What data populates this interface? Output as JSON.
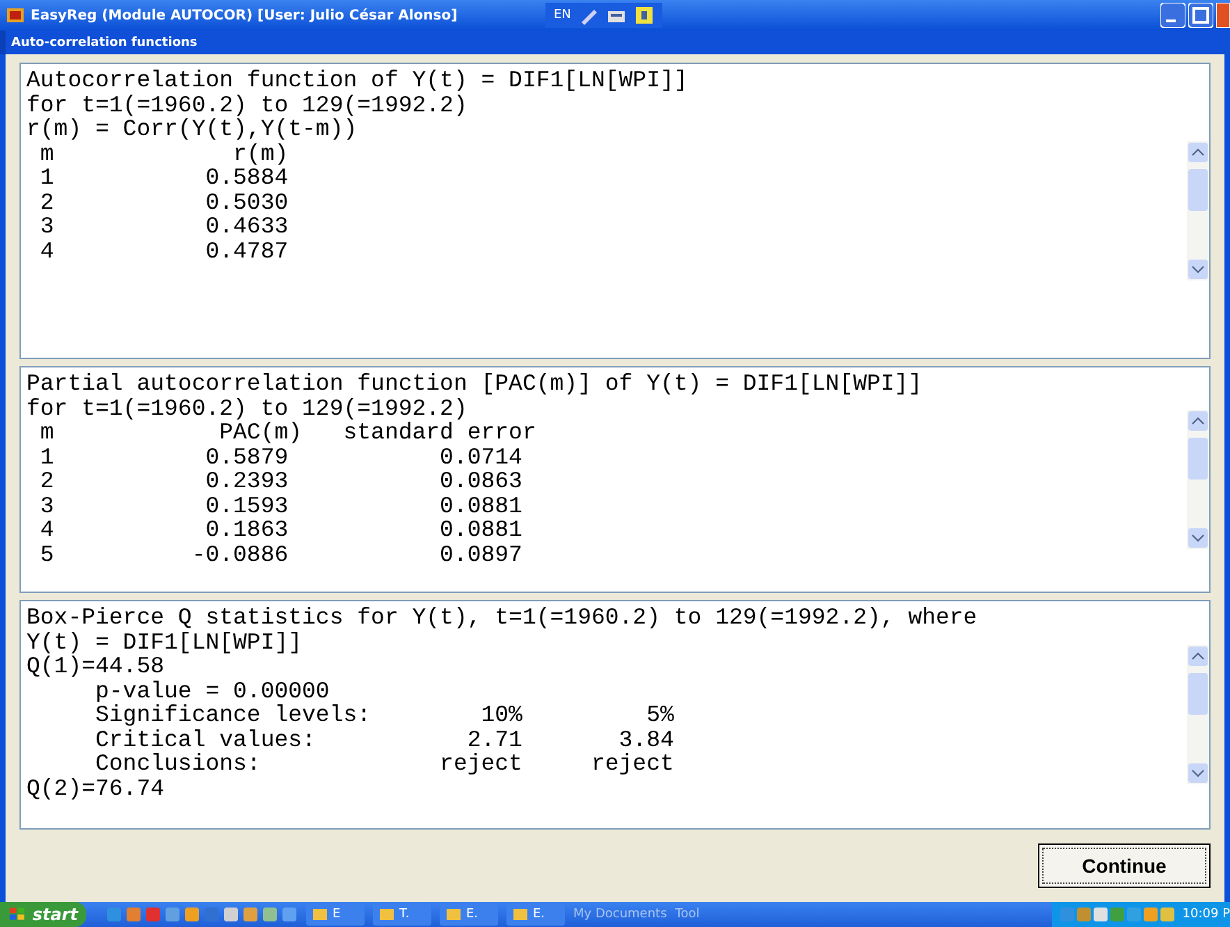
{
  "window": {
    "title": "EasyReg (Module AUTOCOR) [User: Julio César Alonso]",
    "language": "EN"
  },
  "dialog": {
    "title": "Auto-correlation functions"
  },
  "panes": [
    {
      "lines": [
        "Autocorrelation function of Y(t) = DIF1[LN[WPI]]",
        "for t=1(=1960.2) to 129(=1992.2)",
        "r(m) = Corr(Y(t),Y(t-m))",
        " m             r(m)",
        " 1           0.5884",
        " 2           0.5030",
        " 3           0.4633",
        " 4           0.4787"
      ]
    },
    {
      "lines": [
        "Partial autocorrelation function [PAC(m)] of Y(t) = DIF1[LN[WPI]]",
        "for t=1(=1960.2) to 129(=1992.2)",
        " m            PAC(m)   standard error",
        " 1           0.5879           0.0714",
        " 2           0.2393           0.0863",
        " 3           0.1593           0.0881",
        " 4           0.1863           0.0881",
        " 5          -0.0886           0.0897"
      ]
    },
    {
      "lines": [
        "Box-Pierce Q statistics for Y(t), t=1(=1960.2) to 129(=1992.2), where",
        "Y(t) = DIF1[LN[WPI]]",
        "Q(1)=44.58",
        "     p-value = 0.00000",
        "     Significance levels:        10%         5%",
        "     Critical values:           2.71       3.84",
        "     Conclusions:             reject     reject",
        "Q(2)=76.74"
      ]
    }
  ],
  "buttons": [
    {
      "label": "Continue"
    }
  ],
  "taskbar": {
    "start": "start",
    "tasks": [
      {
        "label": "E"
      },
      {
        "label": "T."
      },
      {
        "label": "E."
      },
      {
        "label": "E."
      }
    ],
    "toolbars": [
      "My Documents",
      "Tool"
    ],
    "clock": "10:09 P"
  }
}
